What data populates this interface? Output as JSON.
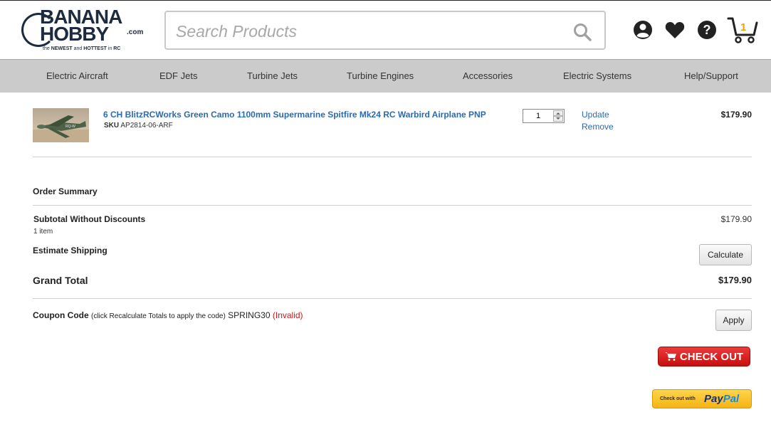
{
  "header": {
    "logo": {
      "line1": "BANANA",
      "line2": "HOBBY",
      "dotcom": ".com",
      "tag_pre": "the ",
      "tag_b1": "NEWEST",
      "tag_mid": " and ",
      "tag_b2": "HOTTEST",
      "tag_in": " in ",
      "tag_rc": "RC"
    },
    "search_placeholder": "Search Products",
    "cart_count": "1",
    "icons": [
      "account-icon",
      "heart-icon",
      "help-icon",
      "cart-icon",
      "search-icon"
    ]
  },
  "nav": [
    "Electric Aircraft",
    "EDF Jets",
    "Turbine Jets",
    "Turbine Engines",
    "Accessories",
    "Electric Systems",
    "Help/Support"
  ],
  "cart": {
    "items": [
      {
        "name": "6 CH BlitzRCWorks Green Camo 1100mm Supermarine Spitfire Mk24 RC Warbird Airplane PNP",
        "sku_label": "SKU",
        "sku": "AP2814-06-ARF",
        "qty": "1",
        "update_label": "Update",
        "remove_label": "Remove",
        "price": "$179.90"
      }
    ]
  },
  "summary": {
    "title": "Order Summary",
    "subtotal_label": "Subtotal Without Discounts",
    "subtotal_value": "$179.90",
    "item_count": "1 item",
    "shipping_label": "Estimate Shipping",
    "calculate_label": "Calculate",
    "grand_total_label": "Grand Total",
    "grand_total_value": "$179.90"
  },
  "coupon": {
    "label": "Coupon Code",
    "note": "(click Recalculate Totals to apply the code)",
    "code": "SPRING30",
    "status": "(Invalid)",
    "apply_label": "Apply"
  },
  "checkout": {
    "label": "CHECK OUT",
    "paypal_small": "Check out with",
    "paypal_pay": "Pay",
    "paypal_pal": "Pal"
  },
  "colors": {
    "link": "#2a6bb0",
    "nav_bg": "#cbcbcb",
    "checkout_red": "#d81c1c",
    "paypal_yellow": "#f8c23a",
    "invalid_red": "#d01818"
  }
}
